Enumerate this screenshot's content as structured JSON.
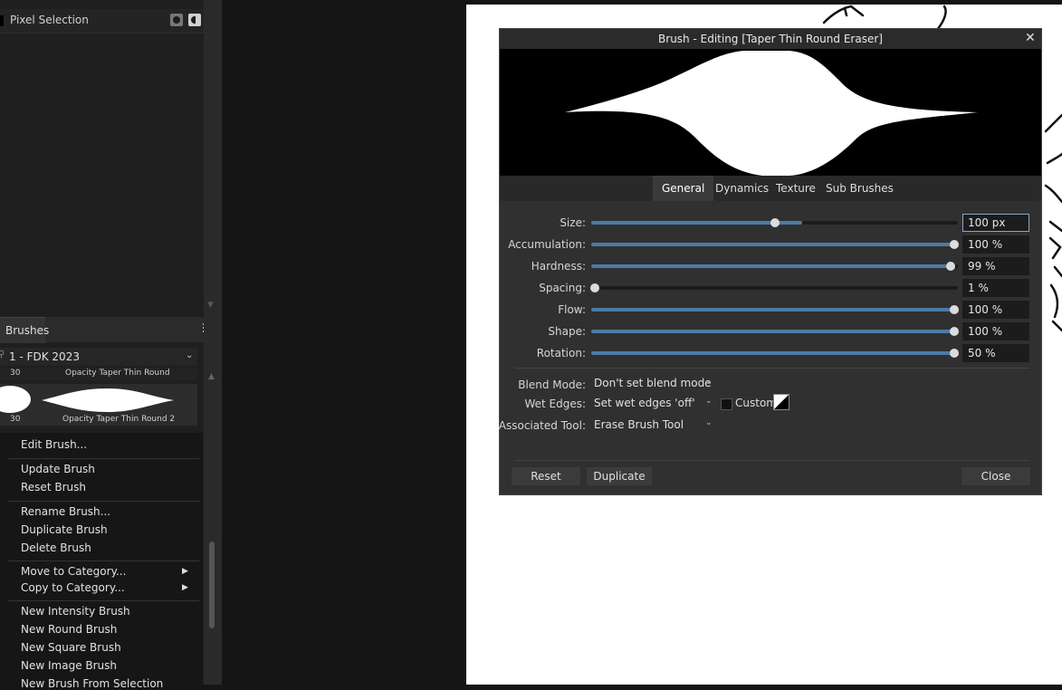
{
  "layers": {
    "item_name": "Pixel Selection"
  },
  "brushes_panel": {
    "tab_label": "Brushes",
    "category": "1 - FDK 2023",
    "brushes": [
      {
        "size": "30",
        "name": "Opacity Taper Thin Round"
      },
      {
        "size": "30",
        "name": "Opacity Taper Thin Round 2"
      }
    ]
  },
  "context_menu": {
    "items": [
      "Edit Brush...",
      "Update Brush",
      "Reset Brush",
      "Rename Brush...",
      "Duplicate Brush",
      "Delete Brush",
      "Move to Category...",
      "Copy to Category...",
      "New Intensity Brush",
      "New Round Brush",
      "New Square Brush",
      "New Image Brush",
      "New Brush From Selection"
    ]
  },
  "dialog": {
    "title": "Brush - Editing [Taper Thin Round Eraser]",
    "close_glyph": "✕",
    "tabs": [
      "General",
      "Dynamics",
      "Texture",
      "Sub Brushes"
    ],
    "active_tab": "General",
    "sliders": [
      {
        "label": "Size:",
        "value": "100 px",
        "fraction": 0.5
      },
      {
        "label": "Accumulation:",
        "value": "100 %",
        "fraction": 1.0
      },
      {
        "label": "Hardness:",
        "value": "99 %",
        "fraction": 0.99
      },
      {
        "label": "Spacing:",
        "value": "1 %",
        "fraction": 0.0
      },
      {
        "label": "Flow:",
        "value": "100 %",
        "fraction": 1.0
      },
      {
        "label": "Shape:",
        "value": "100 %",
        "fraction": 1.0
      },
      {
        "label": "Rotation:",
        "value": "50 %",
        "fraction": 1.0
      }
    ],
    "blend_mode_label": "Blend Mode:",
    "blend_mode_value": "Don't set blend mode",
    "wet_edges_label": "Wet Edges:",
    "wet_edges_value": "Set wet edges 'off'",
    "custom_label": "Custom",
    "associated_tool_label": "Associated Tool:",
    "associated_tool_value": "Erase Brush Tool",
    "buttons": {
      "reset": "Reset",
      "duplicate": "Duplicate",
      "close": "Close"
    }
  },
  "colors": {
    "accent": "#4d7aa8",
    "panel_bg": "#1f1f1f",
    "dialog_bg": "#303030"
  }
}
